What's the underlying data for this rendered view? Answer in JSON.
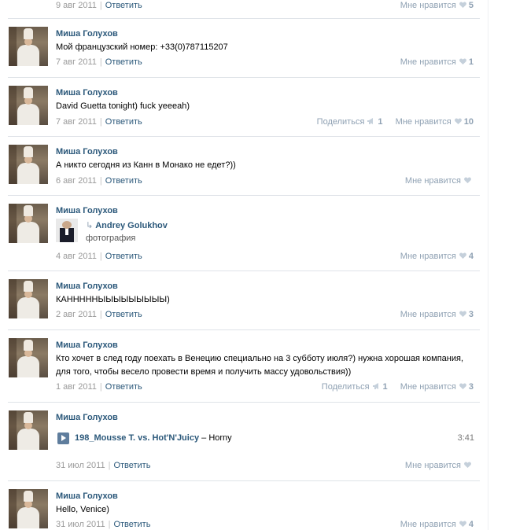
{
  "wall": {
    "posts": [
      {
        "author": "",
        "text": "",
        "date": "9 авг 2011",
        "reply": "Ответить",
        "likes": {
          "label": "Мне нравится",
          "count": "5"
        }
      },
      {
        "author": "Миша Голухов",
        "text": "Мой французский номер: +33(0)787115207",
        "date": "7 авг 2011",
        "reply": "Ответить",
        "likes": {
          "label": "Мне нравится",
          "count": "1"
        }
      },
      {
        "author": "Миша Голухов",
        "text": "David Guetta tonight) fuck yeeeah)",
        "date": "7 авг 2011",
        "reply": "Ответить",
        "share": {
          "label": "Поделиться",
          "count": "1"
        },
        "likes": {
          "label": "Мне нравится",
          "count": "10"
        }
      },
      {
        "author": "Миша Голухов",
        "text": "А никто сегодня из Канн в Монако не едет?))",
        "date": "6 авг 2011",
        "reply": "Ответить",
        "likes": {
          "label": "Мне нравится",
          "count": ""
        }
      },
      {
        "author": "Миша Голухов",
        "repost": {
          "name": "Andrey Golukhov",
          "kind": "фотография"
        },
        "date": "4 авг 2011",
        "reply": "Ответить",
        "likes": {
          "label": "Мне нравится",
          "count": "4"
        }
      },
      {
        "author": "Миша Голухов",
        "text": "КАНННННЫЫЫЫЫЫЫЫЫ)",
        "date": "2 авг 2011",
        "reply": "Ответить",
        "likes": {
          "label": "Мне нравится",
          "count": "3"
        }
      },
      {
        "author": "Миша Голухов",
        "text": "Кто хочет в след году поехать в Венецию специально на 3 субботу июля?) нужна хорошая компания, для того, чтобы весело провести время и получить массу удовольствия))",
        "date": "1 авг 2011",
        "reply": "Ответить",
        "share": {
          "label": "Поделиться",
          "count": "1"
        },
        "likes": {
          "label": "Мне нравится",
          "count": "3"
        }
      },
      {
        "author": "Миша Голухов",
        "audio": {
          "artist": "198_Mousse T. vs. Hot'N'Juicy",
          "dash": "–",
          "title": "Horny",
          "duration": "3:41"
        },
        "date": "31 июл 2011",
        "reply": "Ответить",
        "likes": {
          "label": "Мне нравится",
          "count": ""
        }
      },
      {
        "author": "Миша Голухов",
        "text": "Hello, Venice)",
        "date": "31 июл 2011",
        "reply": "Ответить",
        "likes": {
          "label": "Мне нравится",
          "count": "4"
        }
      }
    ]
  },
  "colors": {
    "link": "#2b587a",
    "muted": "#999999",
    "action": "#8fa1b3",
    "separator": "#dfe3e8"
  },
  "icons": {
    "like": "heart-icon",
    "share": "megaphone-icon",
    "repost": "share-arrow-icon",
    "audio": "play-icon"
  }
}
